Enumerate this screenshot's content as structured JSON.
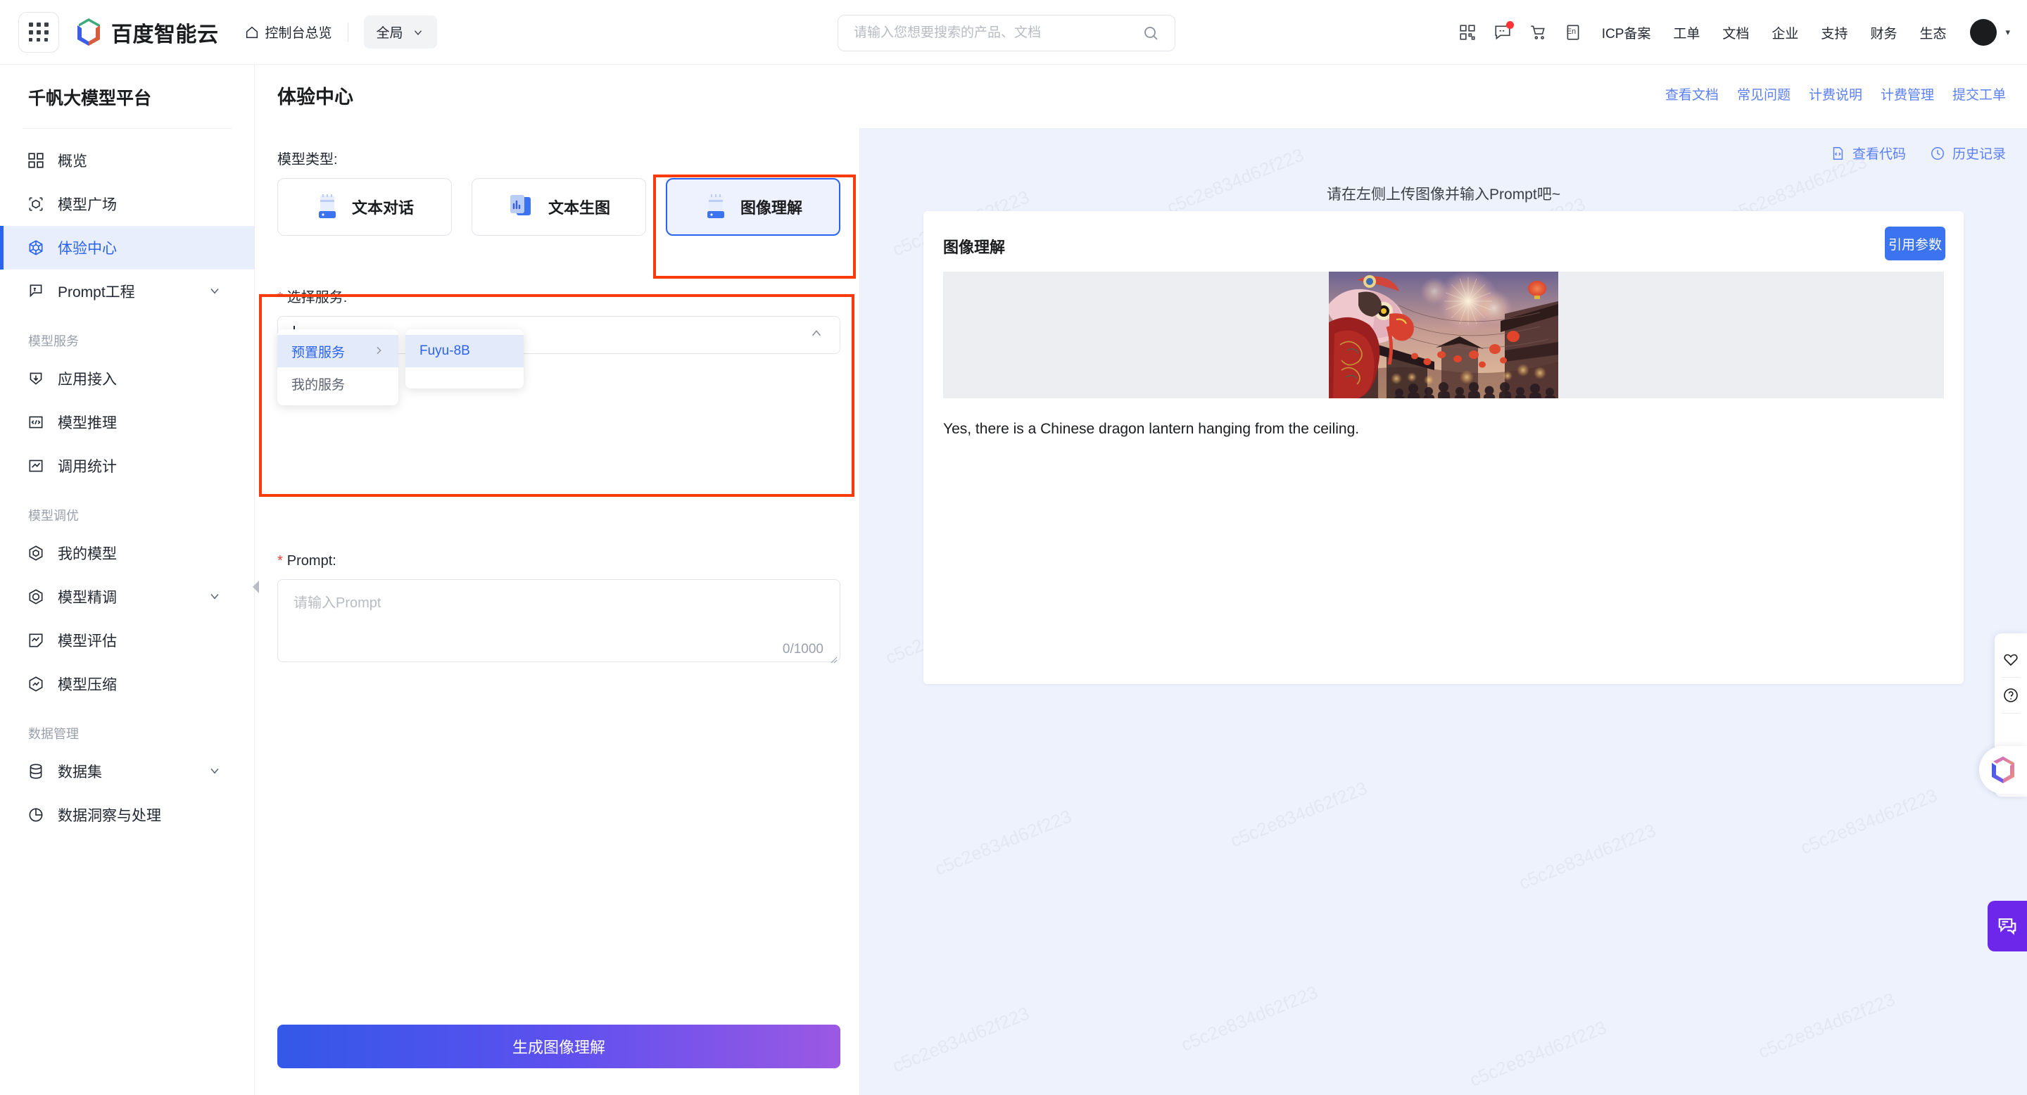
{
  "topbar": {
    "apps_icon": "grid-apps-icon",
    "brand_name": "百度智能云",
    "console_label": "控制台总览",
    "scope_label": "全局",
    "search": {
      "value": "",
      "placeholder": "请输入您想要搜索的产品、文档",
      "icon": "search-icon"
    },
    "icons": [
      {
        "name": "qrcode-icon"
      },
      {
        "name": "message-icon",
        "badge": true
      },
      {
        "name": "cart-icon"
      },
      {
        "name": "language-en-icon",
        "glyph": "En"
      }
    ],
    "links": [
      "ICP备案",
      "工单",
      "文档",
      "企业",
      "支持",
      "财务",
      "生态"
    ],
    "avatar_caret": "▾"
  },
  "sidebar": {
    "title": "千帆大模型平台",
    "items": [
      {
        "label": "概览",
        "icon": "overview-grid-icon",
        "active": false,
        "expandable": false
      },
      {
        "label": "模型广场",
        "icon": "model-plaza-cube-icon",
        "active": false,
        "expandable": false
      },
      {
        "label": "体验中心",
        "icon": "experience-center-cube-icon",
        "active": true,
        "expandable": false
      },
      {
        "label": "Prompt工程",
        "icon": "prompt-bubble-icon",
        "active": false,
        "expandable": true
      }
    ],
    "groups": [
      {
        "label": "模型服务",
        "items": [
          {
            "label": "应用接入",
            "icon": "app-access-download-icon",
            "expandable": false
          },
          {
            "label": "模型推理",
            "icon": "model-inference-code-icon",
            "expandable": false
          },
          {
            "label": "调用统计",
            "icon": "call-stats-chart-icon",
            "expandable": false
          }
        ]
      },
      {
        "label": "模型调优",
        "items": [
          {
            "label": "我的模型",
            "icon": "my-model-hexcube-icon",
            "expandable": false
          },
          {
            "label": "模型精调",
            "icon": "model-finetune-hexcheck-icon",
            "expandable": true
          },
          {
            "label": "模型评估",
            "icon": "model-eval-pen-icon",
            "expandable": false
          },
          {
            "label": "模型压缩",
            "icon": "model-compress-hex-icon",
            "expandable": false
          }
        ]
      },
      {
        "label": "数据管理",
        "items": [
          {
            "label": "数据集",
            "icon": "dataset-database-icon",
            "expandable": true
          },
          {
            "label": "数据洞察与处理",
            "icon": "data-insight-pie-icon",
            "expandable": false
          }
        ]
      }
    ],
    "collapse_handle": "collapse-left-panel-handle"
  },
  "page": {
    "title": "体验中心",
    "header_links": [
      "查看文档",
      "常见问题",
      "计费说明",
      "计费管理",
      "提交工单"
    ]
  },
  "form": {
    "model_type_label": "模型类型:",
    "model_types": [
      {
        "label": "文本对话",
        "icon": "text-chat-icon",
        "selected": false
      },
      {
        "label": "文本生图",
        "icon": "text-to-image-icon",
        "selected": false
      },
      {
        "label": "图像理解",
        "icon": "image-understanding-icon",
        "selected": true
      }
    ],
    "service_label": "选择服务:",
    "service_value": "Fuyu-8B",
    "service_caret": "expanded",
    "dropdown": {
      "categories": [
        {
          "label": "预置服务",
          "highlighted": true,
          "has_submenu": true
        },
        {
          "label": "我的服务",
          "highlighted": false,
          "has_submenu": false
        }
      ],
      "options": [
        {
          "label": "Fuyu-8B",
          "highlighted": true
        }
      ]
    },
    "prompt_label": "Prompt:",
    "prompt_value": "",
    "prompt_placeholder": "请输入Prompt",
    "prompt_counter": "0/1000",
    "submit_label": "生成图像理解"
  },
  "result": {
    "tools": [
      {
        "label": "查看代码",
        "icon": "code-file-icon"
      },
      {
        "label": "历史记录",
        "icon": "history-clock-icon"
      }
    ],
    "hint": "请在左侧上传图像并输入Prompt吧~",
    "card_title": "图像理解",
    "quote_params_label": "引用参数",
    "image_alt": "chinese-new-year-lion-dance-lanterns-fireworks",
    "answer": "Yes, there is a Chinese dragon lantern hanging from the ceiling.",
    "watermark_text": "c5c2e834d62f223"
  },
  "rail": {
    "buttons": [
      {
        "name": "favorite-heart-icon"
      },
      {
        "name": "help-question-icon"
      }
    ],
    "logo": {
      "name": "baidu-cloud-hex-logo-icon"
    },
    "apps": {
      "name": "apps-grid-icon"
    },
    "chat": {
      "name": "chat-support-icon"
    }
  },
  "colors": {
    "accent": "#2b63f0",
    "link": "#5b7ff5",
    "annotation": "#f93a0a",
    "panel_bg": "#eef2fd",
    "chat_purple": "#6c27ea",
    "required_red": "#e8413a"
  }
}
